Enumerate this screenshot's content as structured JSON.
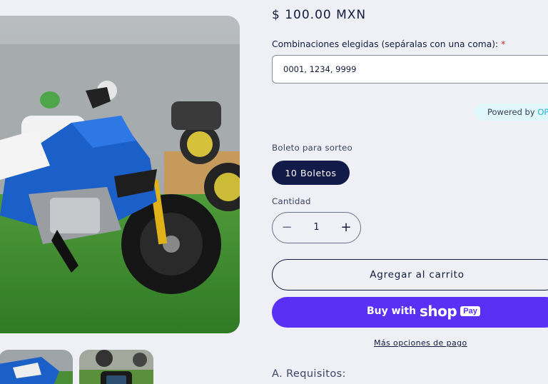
{
  "product": {
    "price": "$ 100.00 MXN",
    "image_alt": "BMW G 310 R motorcycle in blue and white in a showroom",
    "thumb_1": "motorcycle-blue-closeup",
    "thumb_2": "motorcycle-dashboard"
  },
  "combinations": {
    "label": "Combinaciones elegidas (sepáralas con una coma):",
    "required_mark": "*",
    "value": "0001, 1234, 9999"
  },
  "powered_by": {
    "prefix": "Powered by",
    "brand": "OPT"
  },
  "ticket": {
    "label": "Boleto para sorteo",
    "selected_option": "10 Boletos"
  },
  "quantity": {
    "label": "Cantidad",
    "value": "1",
    "minus_symbol": "−",
    "plus_symbol": "+"
  },
  "buttons": {
    "add_to_cart": "Agregar al carrito",
    "buy_with": "Buy with",
    "shop_word": "shop",
    "pay_badge": "Pay",
    "more_options": "Más opciones de pago"
  },
  "sections": {
    "requirements": "A. Requisitos:"
  },
  "colors": {
    "background": "#eef0f6",
    "primary_navy": "#121a4a",
    "shop_pay_purple": "#5a31f4"
  }
}
